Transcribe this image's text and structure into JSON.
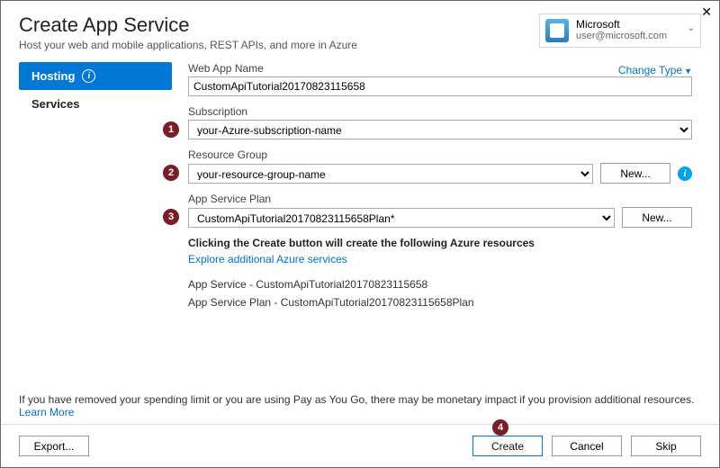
{
  "window": {
    "title": "Create App Service",
    "subtitle": "Host your web and mobile applications, REST APIs, and more in Azure"
  },
  "account": {
    "name": "Microsoft",
    "email": "user@microsoft.com"
  },
  "sidebar": {
    "tabs": [
      {
        "label": "Hosting",
        "active": true,
        "info": true
      },
      {
        "label": "Services",
        "active": false
      }
    ]
  },
  "form": {
    "change_type": "Change Type",
    "webapp_label": "Web App Name",
    "webapp_value": "CustomApiTutorial20170823115658",
    "subscription_label": "Subscription",
    "subscription_value": "your-Azure-subscription-name",
    "rg_label": "Resource Group",
    "rg_value": "your-resource-group-name",
    "plan_label": "App Service Plan",
    "plan_value": "CustomApiTutorial20170823115658Plan*",
    "new_btn": "New...",
    "badges": {
      "b1": "1",
      "b2": "2",
      "b3": "3",
      "b4": "4"
    }
  },
  "summary": {
    "heading": "Clicking the Create button will create the following Azure resources",
    "explore_link": "Explore additional Azure services",
    "lines": [
      "App Service - CustomApiTutorial20170823115658",
      "App Service Plan - CustomApiTutorial20170823115658Plan"
    ]
  },
  "footer_note": {
    "text": "If you have removed your spending limit or you are using Pay as You Go, there may be monetary impact if you provision additional resources.",
    "learn_more": "Learn More"
  },
  "footer": {
    "export": "Export...",
    "create": "Create",
    "cancel": "Cancel",
    "skip": "Skip"
  }
}
